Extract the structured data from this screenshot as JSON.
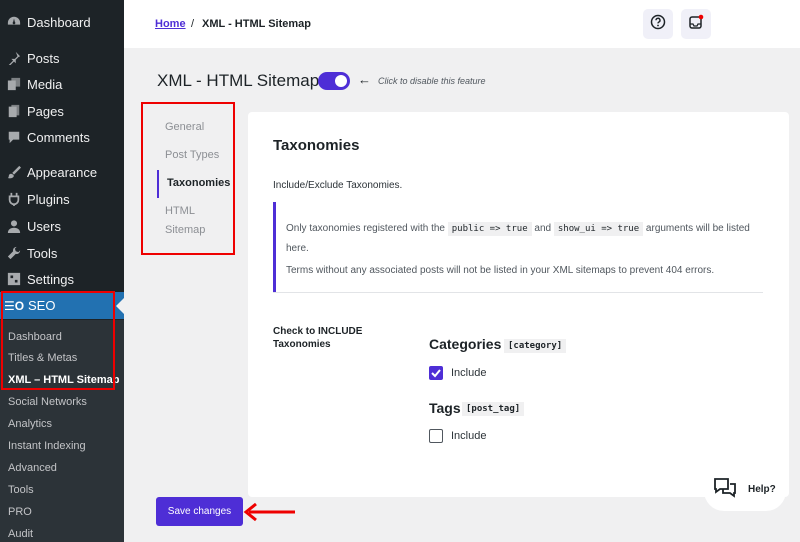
{
  "sidebar": {
    "items": [
      {
        "label": "Dashboard",
        "icon": "dashboard-icon"
      },
      {
        "label": "Posts",
        "icon": "pin-icon"
      },
      {
        "label": "Media",
        "icon": "media-icon"
      },
      {
        "label": "Pages",
        "icon": "pages-icon"
      },
      {
        "label": "Comments",
        "icon": "comment-icon"
      },
      {
        "label": "Appearance",
        "icon": "brush-icon"
      },
      {
        "label": "Plugins",
        "icon": "plugin-icon"
      },
      {
        "label": "Users",
        "icon": "user-icon"
      },
      {
        "label": "Tools",
        "icon": "wrench-icon"
      },
      {
        "label": "Settings",
        "icon": "settings-icon"
      }
    ],
    "seo": {
      "label": "SEO",
      "icon_text": "☰O"
    },
    "submenu": [
      "Dashboard",
      "Titles & Metas",
      "XML – HTML Sitemap",
      "Social Networks",
      "Analytics",
      "Instant Indexing",
      "Advanced",
      "Tools",
      "PRO",
      "Audit"
    ]
  },
  "breadcrumb": {
    "home": "Home",
    "separator": "/",
    "current": "XML - HTML Sitemap"
  },
  "page": {
    "title": "XML - HTML Sitemap",
    "toggle_on": true,
    "toggle_arrow": "←",
    "toggle_hint": "Click to disable this feature"
  },
  "tabs": [
    "General",
    "Post Types",
    "Taxonomies",
    "HTML Sitemap"
  ],
  "active_tab": "Taxonomies",
  "card": {
    "title": "Taxonomies",
    "description": "Include/Exclude Taxonomies.",
    "notice": {
      "line1_pre": "Only taxonomies registered with the",
      "code1": "public => true",
      "and": "and",
      "code2": "show_ui => true",
      "line1_post": "arguments will be listed here.",
      "line2": "Terms without any associated posts will not be listed in your XML sitemaps to prevent 404 errors."
    },
    "include_label": "Check to INCLUDE Taxonomies",
    "taxonomies": [
      {
        "name": "Categories",
        "slug": "[category]",
        "checked": true,
        "checkbox_label": "Include"
      },
      {
        "name": "Tags",
        "slug": "[post_tag]",
        "checked": false,
        "checkbox_label": "Include"
      }
    ]
  },
  "save_button": "Save changes",
  "help": {
    "label": "Help?"
  },
  "colors": {
    "accent": "#4e2ed6",
    "sidebar_bg": "#1d2327",
    "seo_active": "#2271b1",
    "annotation": "#e00000"
  }
}
